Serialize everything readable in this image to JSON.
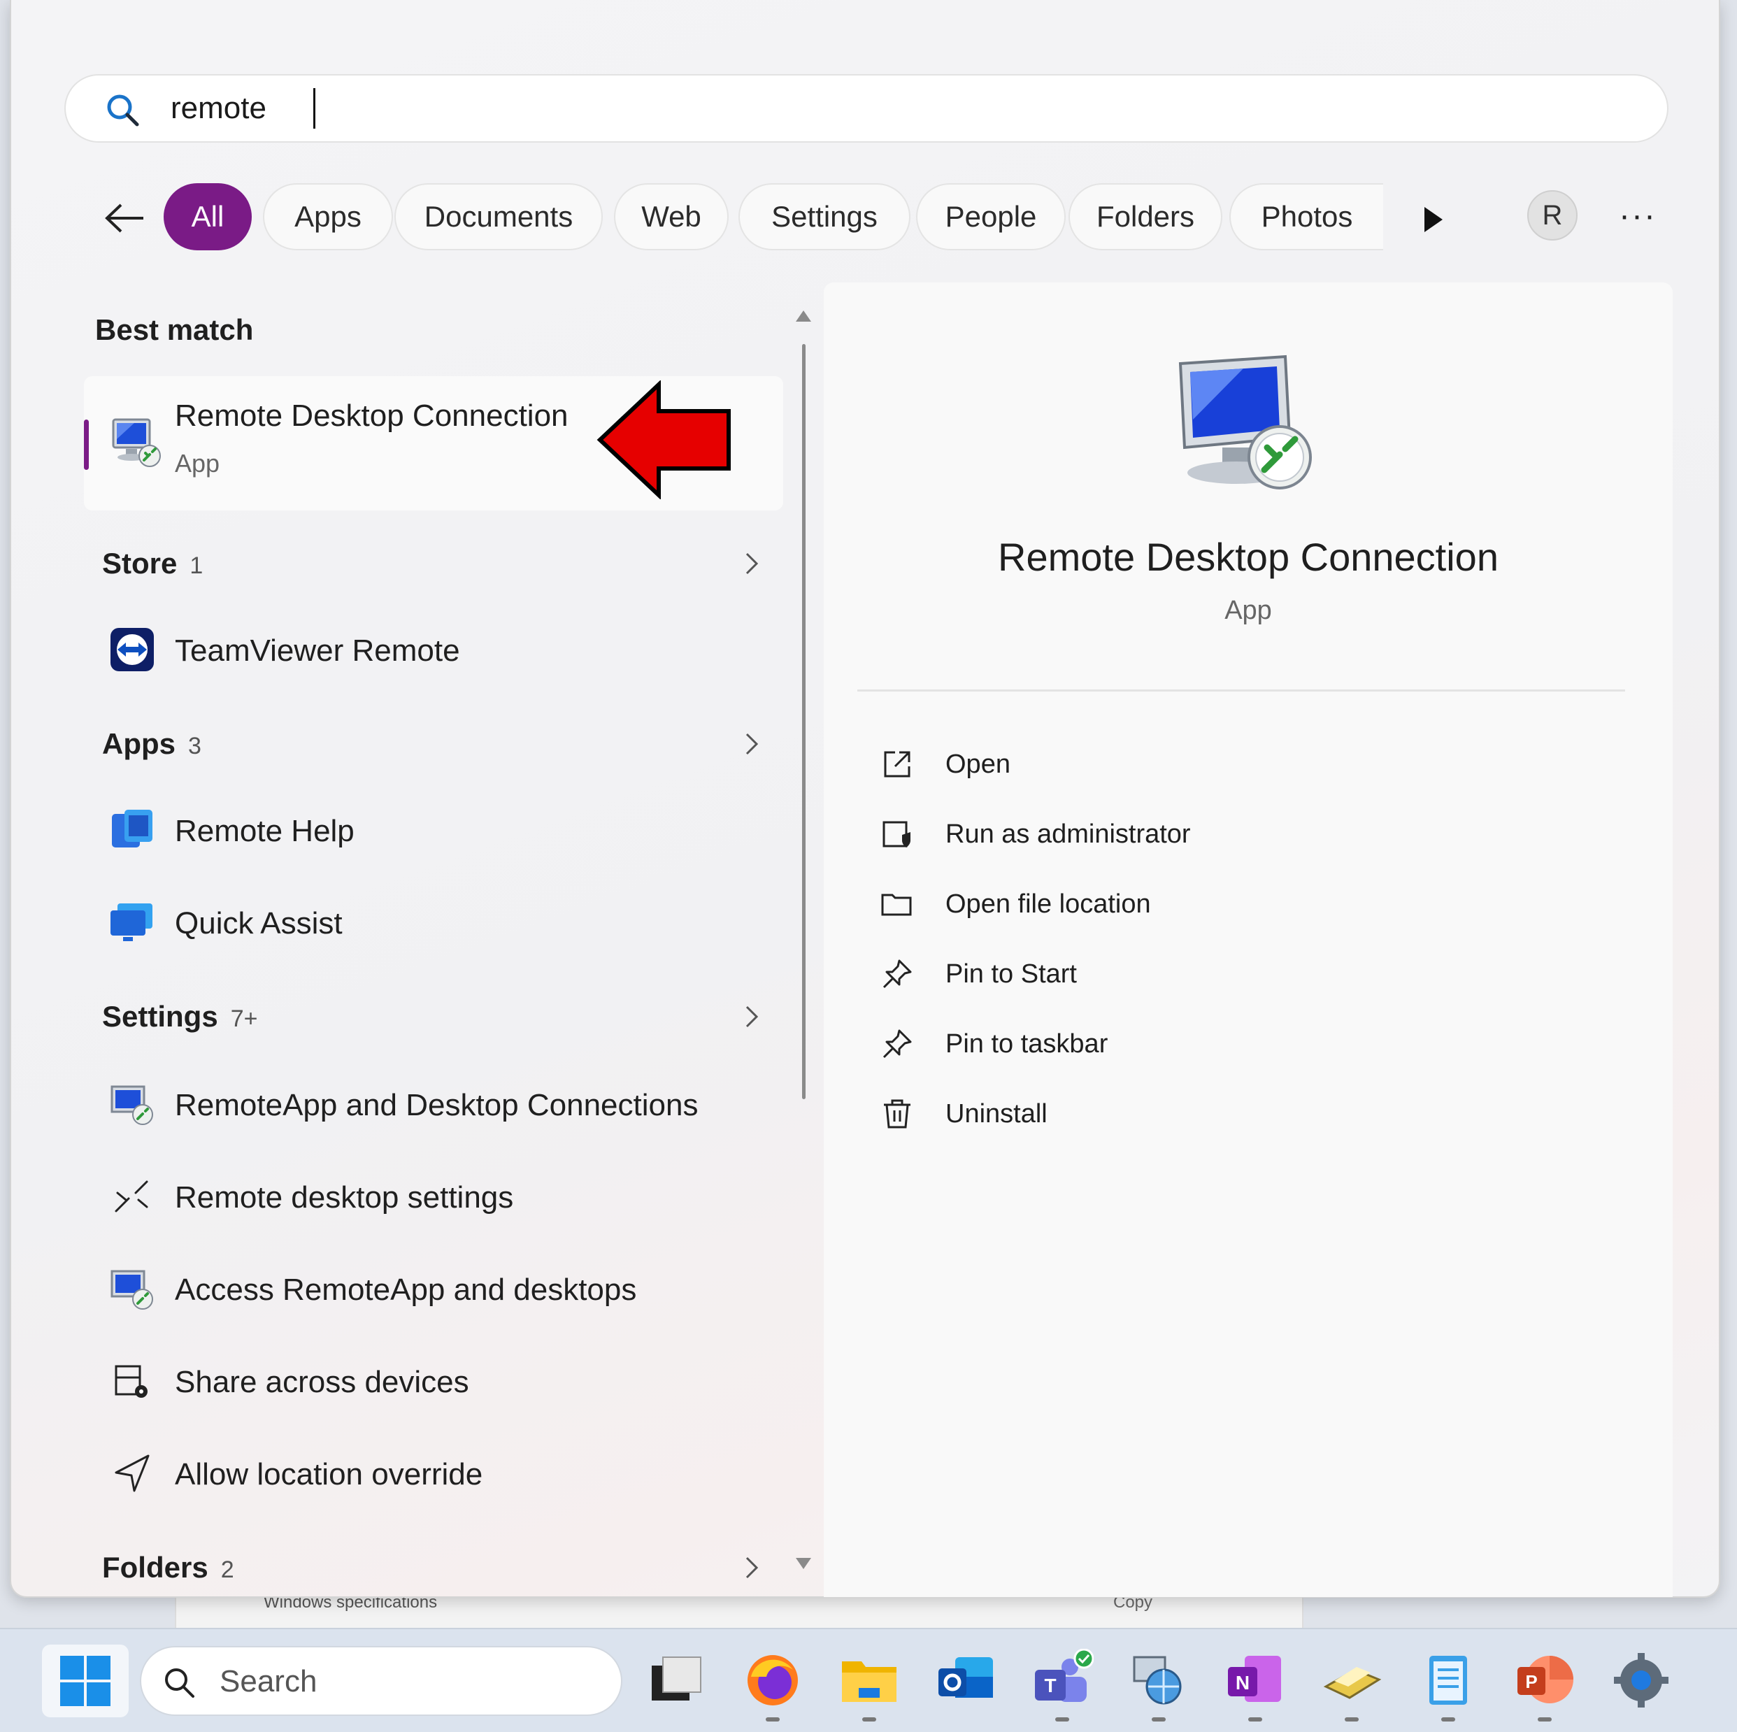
{
  "search": {
    "query": "remote"
  },
  "filters": {
    "back_label": "back",
    "chips": [
      {
        "label": "All",
        "active": true
      },
      {
        "label": "Apps"
      },
      {
        "label": "Documents"
      },
      {
        "label": "Web"
      },
      {
        "label": "Settings"
      },
      {
        "label": "People"
      },
      {
        "label": "Folders"
      },
      {
        "label": "Photos"
      }
    ],
    "avatar_letter": "R",
    "more_label": "···"
  },
  "results": {
    "best_match_title": "Best match",
    "best_match": {
      "name": "Remote Desktop Connection",
      "type": "App"
    },
    "store": {
      "title": "Store",
      "count": "1",
      "items": [
        "TeamViewer Remote"
      ]
    },
    "apps": {
      "title": "Apps",
      "count": "3",
      "items": [
        "Remote Help",
        "Quick Assist"
      ]
    },
    "settings": {
      "title": "Settings",
      "count": "7+",
      "items": [
        "RemoteApp and Desktop Connections",
        "Remote desktop settings",
        "Access RemoteApp and desktops",
        "Share across devices",
        "Allow location override"
      ]
    },
    "folders": {
      "title": "Folders",
      "count": "2"
    }
  },
  "detail": {
    "title": "Remote Desktop Connection",
    "subtitle": "App",
    "actions": [
      "Open",
      "Run as administrator",
      "Open file location",
      "Pin to Start",
      "Pin to taskbar",
      "Uninstall"
    ]
  },
  "background": {
    "window_text": "Windows specifications",
    "copy_label": "Copy"
  },
  "taskbar": {
    "search_placeholder": "Search",
    "apps": [
      "firefox-icon",
      "file-explorer-icon",
      "outlook-icon",
      "teams-icon",
      "network-icon",
      "onenote-icon",
      "scanner-icon",
      "notepad-icon",
      "powerpoint-icon",
      "settings-icon"
    ]
  },
  "colors": {
    "accent": "#7a1b86",
    "arrow": "#e60000"
  }
}
